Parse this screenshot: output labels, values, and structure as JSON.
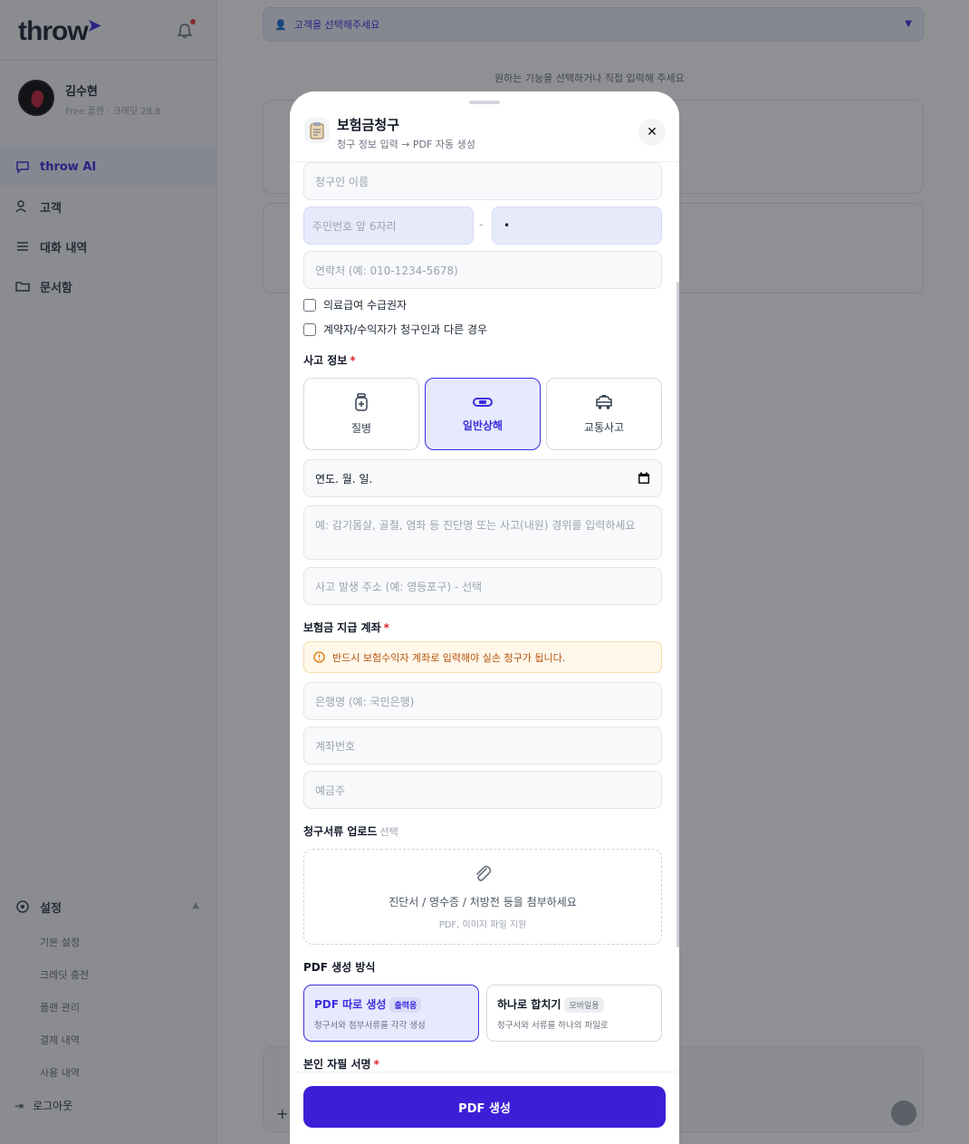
{
  "app": {
    "logo": "throw",
    "profile_name": "김수현",
    "profile_plan": "Free 플랜 · 크레딧 28.8",
    "nav": [
      {
        "label": "throw AI"
      },
      {
        "label": "고객"
      },
      {
        "label": "대화 내역"
      },
      {
        "label": "문서함"
      }
    ],
    "settings_label": "설정",
    "settings_items": [
      "기본 설정",
      "크레딧 충전",
      "플랜 관리",
      "결제 내역",
      "사용 내역"
    ],
    "logout_label": "로그아웃",
    "customer_select_placeholder": "고객을 선택해주세요",
    "main_hint": "원하는 기능을 선택하거나 직접 입력해 주세요"
  },
  "modal": {
    "title": "보험금청구",
    "subtitle": "청구 정보 입력 → PDF 자동 생성",
    "close_label": "✕",
    "claimant_name_placeholder": "청구인 이름",
    "rrn_front_placeholder": "주민번호 앞 6자리",
    "rrn_dash": "-",
    "rrn_back_value": "•",
    "phone_placeholder": "연락처 (예: 010-1234-5678)",
    "checkbox_medical_aid": "의료급여 수급권자",
    "checkbox_contract_diff": "계약자/수익자가 청구인과 다른 경우",
    "accident_section": "사고 정보",
    "accident_types": [
      {
        "label": "질병",
        "icon": "medicine-bottle-icon",
        "selected": false
      },
      {
        "label": "일반상해",
        "icon": "bandage-icon",
        "selected": true
      },
      {
        "label": "교통사고",
        "icon": "car-icon",
        "selected": false
      }
    ],
    "date_value": "연도. 월. 일.",
    "description_placeholder": "예: 감기몸살, 골절, 염좌 등 진단명 또는 사고(내원) 경위를 입력하세요",
    "address_placeholder": "사고 발생 주소 (예: 영등포구) - 선택",
    "account_section": "보험금 지급 계좌",
    "account_warning": "반드시 보험수익자 계좌로 입력해야 실손 청구가 됩니다.",
    "bank_placeholder": "은행명 (예: 국민은행)",
    "account_number_placeholder": "계좌번호",
    "holder_placeholder": "예금주",
    "upload_section": "청구서류 업로드",
    "upload_optional": "선택",
    "upload_main": "진단서 / 영수증 / 처방전 등을 첨부하세요",
    "upload_sub": "PDF, 이미지 파일 지원",
    "pdf_mode_section": "PDF 생성 방식",
    "pdf_modes": [
      {
        "title": "PDF 따로 생성",
        "tag": "출력용",
        "desc": "청구서와 첨부서류를 각각 생성",
        "selected": true
      },
      {
        "title": "하나로 합치기",
        "tag": "모바일용",
        "desc": "청구서와 서류를 하나의 파일로",
        "selected": false
      }
    ],
    "signature_section": "본인 자필 서명",
    "submit_label": "PDF 생성"
  },
  "colors": {
    "accent": "#3b2fe0",
    "button": "#3b1fd6",
    "warning_bg": "#fff7ea",
    "warning_text": "#b45309",
    "required": "#dc2626"
  }
}
